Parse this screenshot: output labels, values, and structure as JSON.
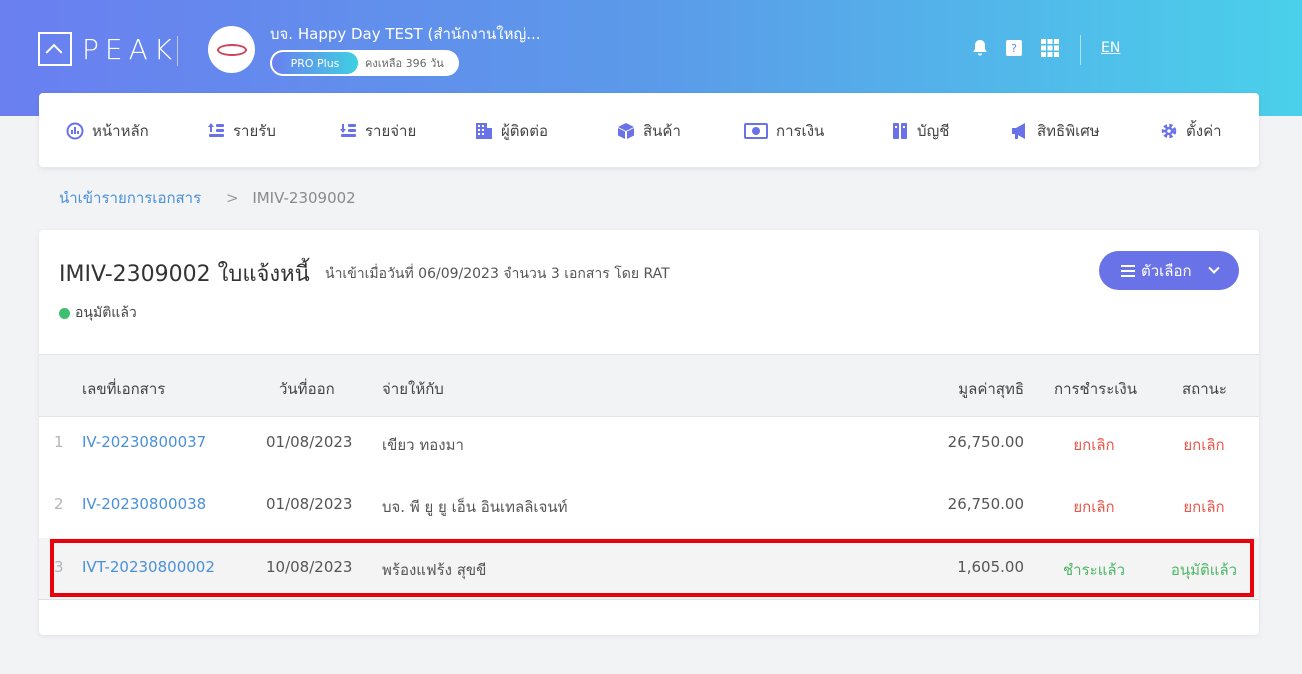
{
  "header": {
    "brand": "PEAK",
    "company_name": "บจ. Happy Day TEST (สำนักงานใหญ่...",
    "plan_badge": "PRO Plus",
    "plan_remaining": "คงเหลือ 396 วัน",
    "language": "EN",
    "icons": [
      "bell-icon",
      "help-book-icon",
      "apps-grid-icon"
    ]
  },
  "nav": [
    {
      "label": "หน้าหลัก",
      "icon": "dashboard-icon"
    },
    {
      "label": "รายรับ",
      "icon": "income-icon"
    },
    {
      "label": "รายจ่าย",
      "icon": "expense-icon"
    },
    {
      "label": "ผู้ติดต่อ",
      "icon": "contacts-building-icon"
    },
    {
      "label": "สินค้า",
      "icon": "product-box-icon"
    },
    {
      "label": "การเงิน",
      "icon": "money-icon"
    },
    {
      "label": "บัญชี",
      "icon": "ledger-book-icon"
    },
    {
      "label": "สิทธิพิเศษ",
      "icon": "megaphone-icon"
    },
    {
      "label": "ตั้งค่า",
      "icon": "gear-icon"
    }
  ],
  "breadcrumb": {
    "parent": "นำเข้ารายการเอกสาร",
    "separator": ">",
    "current": "IMIV-2309002"
  },
  "document": {
    "title": "IMIV-2309002 ใบแจ้งหนี้",
    "meta": "นำเข้าเมื่อวันที่ 06/09/2023 จำนวน 3 เอกสาร โดย RAT",
    "status": "อนุมัติแล้ว",
    "options_button": "ตัวเลือก"
  },
  "table": {
    "columns": [
      "เลขที่เอกสาร",
      "วันที่ออก",
      "จ่ายให้กับ",
      "มูลค่าสุทธิ",
      "การชำระเงิน",
      "สถานะ"
    ],
    "rows": [
      {
        "no": "1",
        "doc": "IV-20230800037",
        "date": "01/08/2023",
        "payee": "เขียว ทองมา",
        "amount": "26,750.00",
        "payment": "ยกเลิก",
        "status": "ยกเลิก"
      },
      {
        "no": "2",
        "doc": "IV-20230800038",
        "date": "01/08/2023",
        "payee": "บจ. พี ยู ยู เอ็น อินเทลลิเจนท์",
        "amount": "26,750.00",
        "payment": "ยกเลิก",
        "status": "ยกเลิก"
      },
      {
        "no": "3",
        "doc": "IVT-20230800002",
        "date": "10/08/2023",
        "payee": "พร้องแฟร้ง สุขขี",
        "amount": "1,605.00",
        "payment": "ชำระแล้ว",
        "status": "อนุมัติแล้ว"
      }
    ]
  },
  "colors": {
    "accent": "#6a72e8",
    "link": "#4a90d9",
    "cancelled": "#e8564a",
    "approved": "#4cb866",
    "highlight": "#e8000b"
  }
}
